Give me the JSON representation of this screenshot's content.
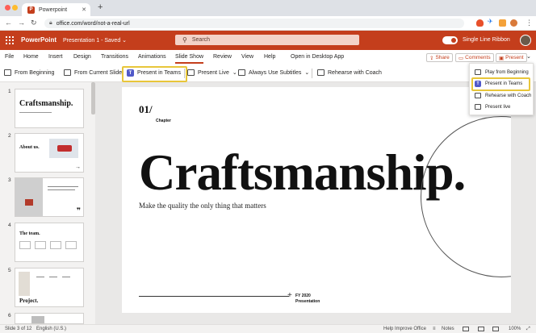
{
  "browser": {
    "tab_title": "Powerpoint",
    "tab_logo": "P",
    "url": "office.com/word/not-a-real-url",
    "new_tab": "+"
  },
  "office": {
    "app_name": "PowerPoint",
    "doc_name": "Presentation 1 - Saved",
    "search_placeholder": "Search",
    "single_line_ribbon": "Single Line Ribbon",
    "brand_color": "#c43e1c"
  },
  "menu": {
    "items": [
      "File",
      "Home",
      "Insert",
      "Design",
      "Transitions",
      "Animations",
      "Slide Show",
      "Review",
      "View",
      "Help",
      "Open in Desktop App"
    ],
    "active": "Slide Show",
    "share": "Share",
    "comments": "Comments",
    "present": "Present"
  },
  "ribbon": {
    "from_beginning": "From Beginning",
    "from_current": "From Current Slide",
    "present_in_teams": "Present in Teams",
    "present_live": "Present Live",
    "subtitles": "Always Use Subtitles",
    "rehearse": "Rehearse with Coach"
  },
  "dropdown": {
    "items": [
      "Play from Beginning",
      "Present in Teams",
      "Rehearse with Coach",
      "Present live"
    ],
    "highlighted": "Present in Teams"
  },
  "thumbnails": [
    {
      "num": "1",
      "title": "Craftsmanship."
    },
    {
      "num": "2",
      "title": "About us."
    },
    {
      "num": "3",
      "title": ""
    },
    {
      "num": "4",
      "title": "The team."
    },
    {
      "num": "5",
      "title": "Project."
    },
    {
      "num": "6",
      "title": ""
    }
  ],
  "slide": {
    "number": "01/",
    "chapter": "Chapter",
    "title": "Craftsmanship.",
    "subtitle": "Make the quality the only thing that matters",
    "fy": "FY 2020",
    "presentation": "Presentation"
  },
  "status": {
    "slide_count": "Slide 3 of 12",
    "language": "English (U.S.)",
    "help": "Help Improve Office",
    "notes": "Notes",
    "zoom": "100%"
  },
  "highlight_color": "#e8c63a"
}
